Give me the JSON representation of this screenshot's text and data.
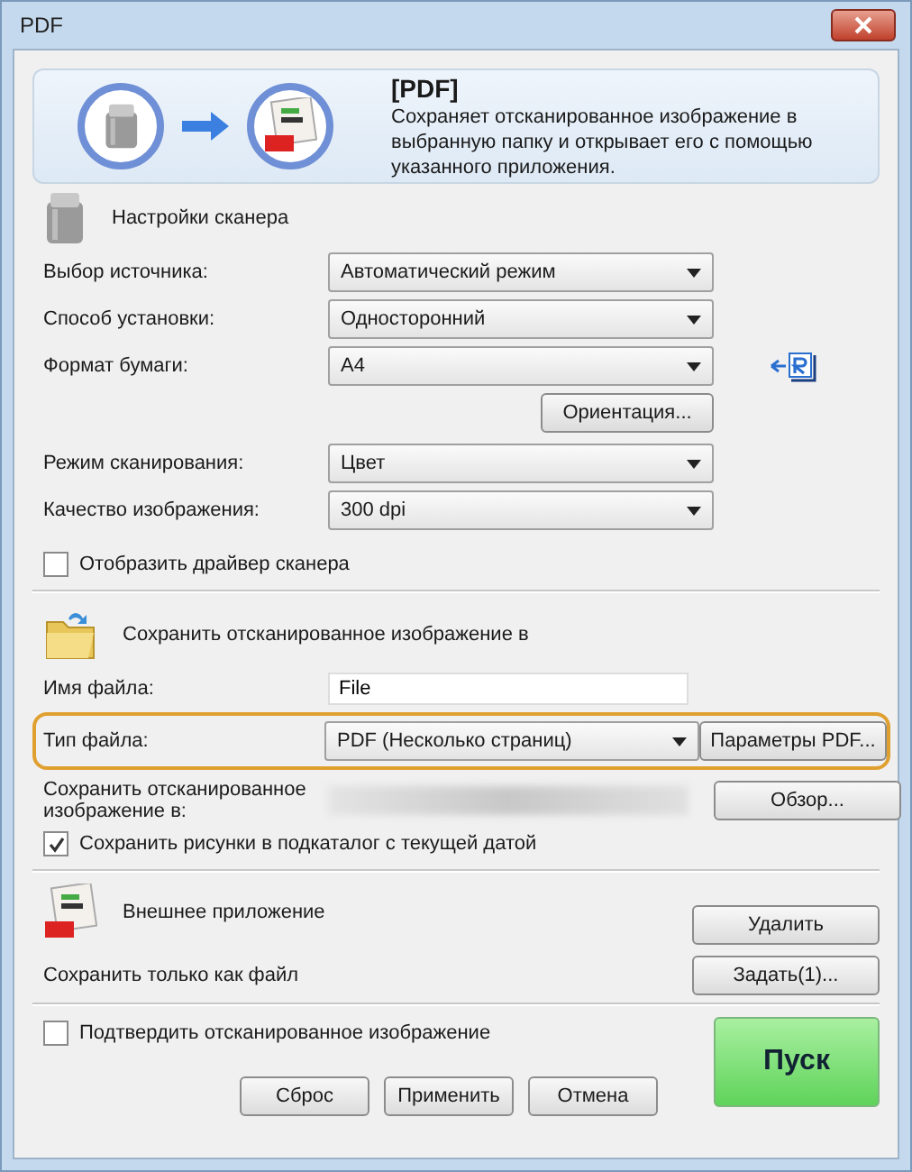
{
  "window": {
    "title": "PDF"
  },
  "header": {
    "title": "[PDF]",
    "description": "Сохраняет отсканированное изображение в выбранную папку и открывает его с помощью указанного приложения."
  },
  "scanner_settings": {
    "heading": "Настройки сканера",
    "paper_fields": [
      {
        "label": "Выбор источника:",
        "value": "Автоматический режим"
      },
      {
        "label": "Способ установки:",
        "value": "Односторонний"
      },
      {
        "label": "Формат бумаги:",
        "value": "A4"
      }
    ],
    "orientation_button": "Ориентация...",
    "mode_fields": [
      {
        "label": "Режим сканирования:",
        "value": "Цвет"
      },
      {
        "label": "Качество изображения:",
        "value": "300 dpi"
      }
    ],
    "show_driver": {
      "label": "Отобразить драйвер сканера",
      "checked": false
    }
  },
  "save": {
    "heading": "Сохранить отсканированное изображение в",
    "file_name": {
      "label": "Имя файла:",
      "value": "File"
    },
    "file_type": {
      "label": "Тип файла:",
      "value": "PDF (Несколько страниц)",
      "button": "Параметры PDF..."
    },
    "location": {
      "label": "Сохранить отсканированное изображение в:",
      "button": "Обзор..."
    },
    "subfolder": {
      "label": "Сохранить рисунки в подкаталог с текущей датой",
      "checked": true
    }
  },
  "application": {
    "heading": "Внешнее приложение",
    "value": "Сохранить только как файл",
    "buttons": [
      "Удалить",
      "Задать(1)..."
    ]
  },
  "confirm": {
    "label": "Подтвердить отсканированное изображение",
    "checked": false
  },
  "buttons": [
    "Сброс",
    "Применить",
    "Отмена"
  ],
  "start": "Пуск"
}
